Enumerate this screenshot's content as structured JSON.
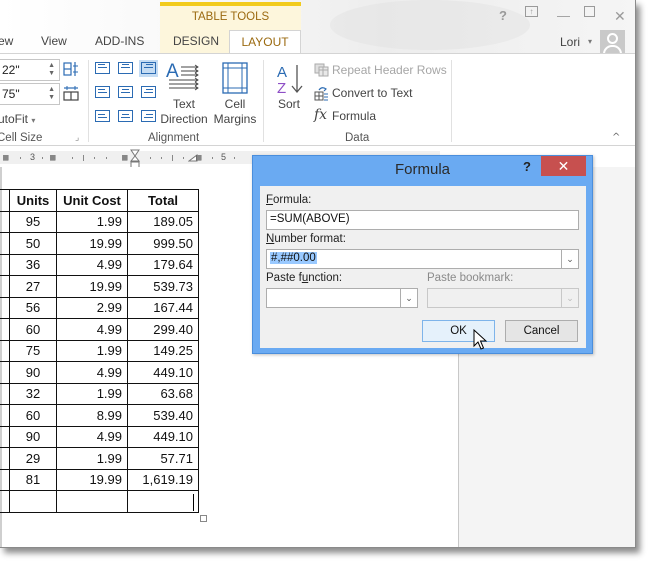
{
  "titlebar": {
    "contextual_group": "TABLE TOOLS",
    "controls": {
      "help": "?",
      "ribbon_display": "⊼",
      "minimize": "—",
      "maximize": "☐",
      "close": "✕"
    },
    "user": {
      "name": "Lori",
      "caret": "▾"
    }
  },
  "tabs": [
    {
      "label": "ew"
    },
    {
      "label": "View"
    },
    {
      "label": "ADD-INS"
    },
    {
      "label": "DESIGN"
    },
    {
      "label": "LAYOUT",
      "active": true
    }
  ],
  "ribbon": {
    "cell_size": {
      "height_value": "22\"",
      "width_value": "75\"",
      "autofit_label": "utoFit",
      "autofit_caret": "▾",
      "group_label": "Cell Size",
      "launcher": "⌟"
    },
    "alignment": {
      "selected": "top-right",
      "text_direction_label": [
        "Text",
        "Direction"
      ],
      "cell_margins_label": [
        "Cell",
        "Margins"
      ],
      "group_label": "Alignment"
    },
    "data": {
      "sort_label": "Sort",
      "repeat_header_rows": "Repeat Header Rows",
      "convert_to_text": "Convert to Text",
      "formula": "Formula",
      "fx_glyph": "fx",
      "group_label": "Data"
    },
    "collapse_glyph": "^"
  },
  "ruler": {
    "numbers": [
      "3",
      "5"
    ]
  },
  "table": {
    "headers": [
      "",
      "Units",
      "Unit Cost",
      "Total"
    ],
    "rows": [
      [
        "",
        "95",
        "1.99",
        "189.05"
      ],
      [
        "",
        "50",
        "19.99",
        "999.50"
      ],
      [
        "",
        "36",
        "4.99",
        "179.64"
      ],
      [
        "",
        "27",
        "19.99",
        "539.73"
      ],
      [
        "",
        "56",
        "2.99",
        "167.44"
      ],
      [
        "",
        "60",
        "4.99",
        "299.40"
      ],
      [
        "",
        "75",
        "1.99",
        "149.25"
      ],
      [
        "",
        "90",
        "4.99",
        "449.10"
      ],
      [
        "",
        "32",
        "1.99",
        "63.68"
      ],
      [
        "",
        "60",
        "8.99",
        "539.40"
      ],
      [
        "",
        "90",
        "4.99",
        "449.10"
      ],
      [
        "",
        "29",
        "1.99",
        "57.71"
      ],
      [
        "",
        "81",
        "19.99",
        "1,619.19"
      ],
      [
        "",
        "",
        "",
        ""
      ]
    ]
  },
  "dialog": {
    "title": "Formula",
    "help": "?",
    "close": "✕",
    "formula_label_accel": "F",
    "formula_label_rest": "ormula:",
    "formula_value": "=SUM(ABOVE)",
    "number_format_label_accel": "N",
    "number_format_label_rest": "umber format:",
    "number_format_value": "#,##0.00",
    "paste_function_label_pre": "Paste f",
    "paste_function_label_accel": "u",
    "paste_function_label_post": "nction:",
    "paste_function_value": "",
    "paste_bookmark_label": "Paste bookmark:",
    "paste_bookmark_value": "",
    "ok_label": "OK",
    "cancel_label": "Cancel",
    "dropdown_glyph": "⌄"
  }
}
